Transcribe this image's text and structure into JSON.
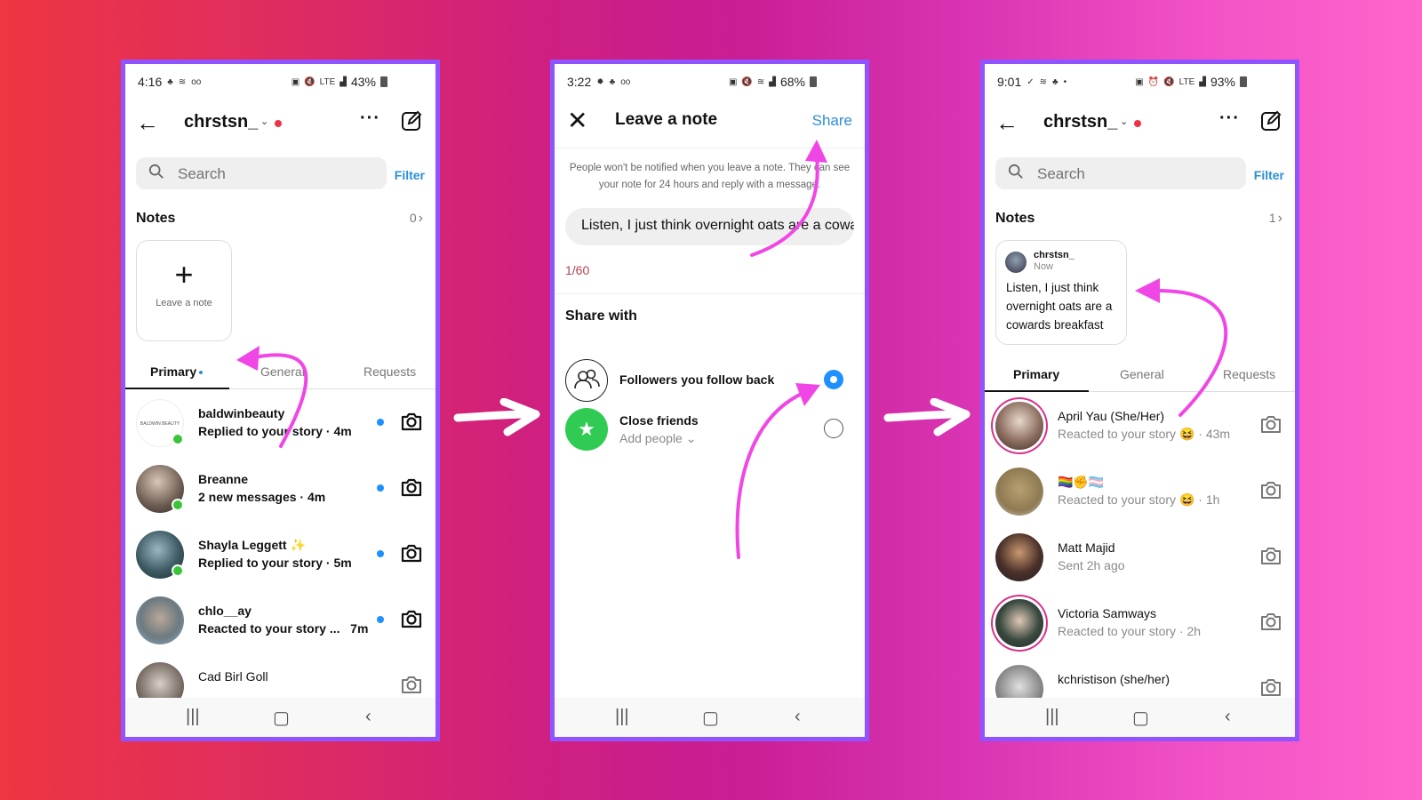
{
  "colors": {
    "accent_blue": "#2a8fd6",
    "frame_purple": "#8f54ff",
    "annotation_magenta": "#f046e6",
    "online_green": "#3ac43a",
    "notification_red": "#ed3446"
  },
  "phone1": {
    "status": {
      "time": "4:16",
      "battery": "43%",
      "left_icons": [
        "activity-icon",
        "wifi-icon",
        "voicemail-icon"
      ],
      "right_icons": [
        "battery-saver-icon",
        "mute-icon",
        "lte-icon",
        "signal-icon"
      ]
    },
    "header": {
      "username": "chrstsn_",
      "back_icon": "arrow-left-icon",
      "more_icon": "more-icon",
      "compose_icon": "compose-icon"
    },
    "search": {
      "placeholder": "Search",
      "filter_label": "Filter"
    },
    "notes": {
      "title": "Notes",
      "count": "0",
      "leave_note_label": "Leave a note"
    },
    "tabs": [
      {
        "label": "Primary",
        "active": true
      },
      {
        "label": "General"
      },
      {
        "label": "Requests"
      }
    ],
    "messages": [
      {
        "name": "baldwinbeauty",
        "sub": "Replied to your story · 4m",
        "unread": true,
        "online": true,
        "avatar_text": "BALDWIN BEAUTY"
      },
      {
        "name": "Breanne",
        "sub": "2 new messages · 4m",
        "unread": true,
        "online": true
      },
      {
        "name": "Shayla Leggett ✨",
        "sub": "Replied to your story · 5m",
        "unread": true,
        "online": true
      },
      {
        "name": "chlo__ay",
        "sub": "Reacted to your story ...   7m",
        "unread": true,
        "online": false
      },
      {
        "name": "Cad Birl Goll",
        "sub": "",
        "unread": false,
        "online": false
      }
    ]
  },
  "phone2": {
    "status": {
      "time": "3:22",
      "battery": "68%",
      "left_icons": [
        "brightness-icon",
        "activity-icon",
        "voicemail-icon"
      ],
      "right_icons": [
        "battery-saver-icon",
        "mute-icon",
        "wifi-icon",
        "signal-icon"
      ]
    },
    "header": {
      "title": "Leave a note",
      "share_label": "Share",
      "close_icon": "close-icon"
    },
    "info_text": "People won't be notified when you leave a note. They can see your note for 24 hours and reply with a message.",
    "note_value": "Listen, I just think overnight oats are a cowards breakfast",
    "counter": "1/60",
    "share_with_title": "Share with",
    "options": [
      {
        "title": "Followers you follow back",
        "selected": true,
        "icon": "people-icon"
      },
      {
        "title": "Close friends",
        "sub": "Add people ⌄",
        "selected": false,
        "icon": "star-icon"
      }
    ]
  },
  "phone3": {
    "status": {
      "time": "9:01",
      "battery": "93%",
      "left_icons": [
        "check-circle-icon",
        "wifi-icon",
        "activity-icon",
        "dot-icon"
      ],
      "right_icons": [
        "battery-saver-icon",
        "alarm-icon",
        "mute-icon",
        "lte-icon",
        "signal-icon"
      ]
    },
    "header": {
      "username": "chrstsn_"
    },
    "search": {
      "placeholder": "Search",
      "filter_label": "Filter"
    },
    "notes": {
      "title": "Notes",
      "count": "1",
      "card_user": "chrstsn_",
      "card_time": "Now",
      "card_text": "Listen, I just think overnight oats are a cowards breakfast"
    },
    "tabs": [
      {
        "label": "Primary",
        "active": true
      },
      {
        "label": "General"
      },
      {
        "label": "Requests"
      }
    ],
    "messages": [
      {
        "name": "April Yau (She/Her)",
        "sub": "Reacted to your story 😆 · 43m",
        "story_ring": true
      },
      {
        "name": "🏳️‍🌈✊🏳️‍⚧️",
        "sub": "Reacted to your story 😆 · 1h",
        "story_ring": false
      },
      {
        "name": "Matt Majid",
        "sub": "Sent 2h ago",
        "story_ring": false
      },
      {
        "name": "Victoria Samways",
        "sub": "Reacted to your story · 2h",
        "story_ring": true
      },
      {
        "name": "kchristison (she/her)",
        "sub": "",
        "story_ring": false
      }
    ]
  },
  "navbar": {
    "recents": "|||",
    "home": "▢",
    "back": "‹"
  }
}
